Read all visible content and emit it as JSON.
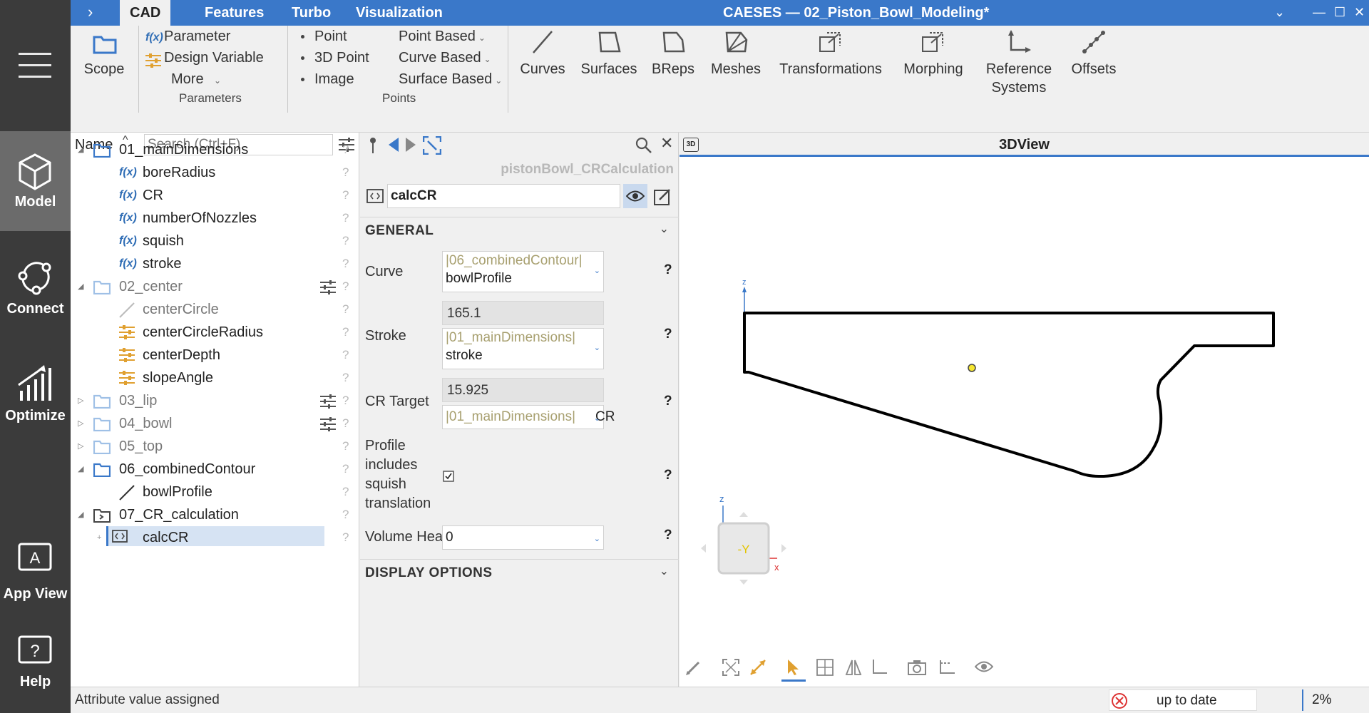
{
  "app": {
    "title": "CAESES — 02_Piston_Bowl_Modeling*"
  },
  "tabs": [
    {
      "label": "CAD"
    },
    {
      "label": "Features"
    },
    {
      "label": "Turbo"
    },
    {
      "label": "Visualization"
    }
  ],
  "rail": {
    "items": [
      {
        "label": "Model"
      },
      {
        "label": "Connect"
      },
      {
        "label": "Optimize"
      },
      {
        "label": "App View"
      },
      {
        "label": "Help"
      }
    ]
  },
  "ribbon": {
    "scope": "Scope",
    "parameter": "Parameter",
    "design_variable": "Design Variable",
    "more": "More",
    "parameters_group": "Parameters",
    "point": "Point",
    "point3d": "3D Point",
    "image": "Image",
    "point_based": "Point Based",
    "curve_based": "Curve Based",
    "surface_based": "Surface Based",
    "points_group": "Points",
    "curves": "Curves",
    "surfaces": "Surfaces",
    "breps": "BReps",
    "meshes": "Meshes",
    "transformations": "Transformations",
    "morphing": "Morphing",
    "reference_systems_1": "Reference",
    "reference_systems_2": "Systems",
    "offsets": "Offsets"
  },
  "tree": {
    "name_header": "Name",
    "search_placeholder": "Search (Ctrl+F)",
    "rows": [
      {
        "label": "01_mainDimensions"
      },
      {
        "label": "boreRadius"
      },
      {
        "label": "CR"
      },
      {
        "label": "numberOfNozzles"
      },
      {
        "label": "squish"
      },
      {
        "label": "stroke"
      },
      {
        "label": "02_center"
      },
      {
        "label": "centerCircle"
      },
      {
        "label": "centerCircleRadius"
      },
      {
        "label": "centerDepth"
      },
      {
        "label": "slopeAngle"
      },
      {
        "label": "03_lip"
      },
      {
        "label": "04_bowl"
      },
      {
        "label": "05_top"
      },
      {
        "label": "06_combinedContour"
      },
      {
        "label": "bowlProfile"
      },
      {
        "label": "07_CR_calculation"
      },
      {
        "label": "calcCR"
      }
    ],
    "fx_label": "f(x)",
    "q": "?"
  },
  "props": {
    "breadcrumb": "pistonBowl_CRCalculation",
    "name": "calcCR",
    "general": "GENERAL",
    "curve_label": "Curve",
    "curve_ref": "|06_combinedContour|",
    "curve_value": "bowlProfile",
    "stroke_label": "Stroke",
    "stroke_computed": "165.1",
    "stroke_ref": "|01_mainDimensions|",
    "stroke_value": "stroke",
    "cr_label": "CR Target",
    "cr_computed": "15.925",
    "cr_ref": "|01_mainDimensions|",
    "cr_value": "CR",
    "profile_label_1": "Profile",
    "profile_label_2": "includes",
    "profile_label_3": "squish",
    "profile_label_4": "translation",
    "volume_label": "Volume Head",
    "volume_value": "0",
    "display_options": "DISPLAY OPTIONS",
    "q": "?"
  },
  "view": {
    "title": "3DView",
    "tag": "3D",
    "axis_z": "z",
    "axis_z2": "z",
    "axis_x": "x",
    "cube_face": "-Y"
  },
  "status": {
    "message": "Attribute value assigned",
    "state": "up to date",
    "percent": "2%"
  },
  "colors": {
    "accent": "#3a78c9",
    "rail": "#3b3b3b",
    "folder": "#3a78c9",
    "design_variable": "#e0a030"
  }
}
